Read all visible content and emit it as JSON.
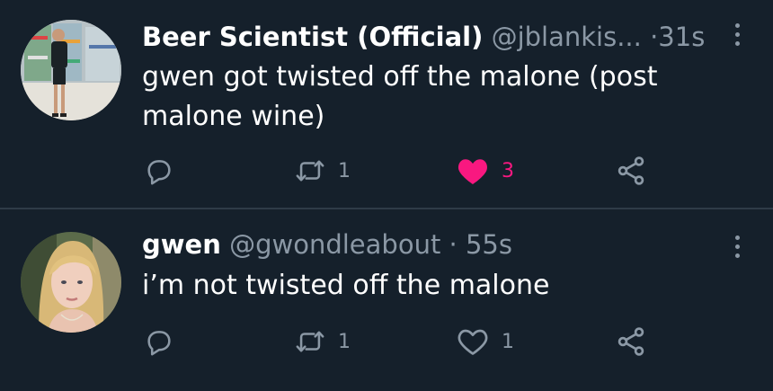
{
  "tweets": [
    {
      "name": "Beer Scientist (Official)",
      "handle": "@jblankis...",
      "separator": "·",
      "time": "31s",
      "text_lines": [
        "gwen got twisted off the malone (post",
        "malone wine)"
      ],
      "retweets": "1",
      "likes": "3",
      "liked": true
    },
    {
      "name": "gwen",
      "handle": "@gwondleabout",
      "separator": "·",
      "time": "55s",
      "text_lines": [
        "i’m not twisted off the malone"
      ],
      "retweets": "1",
      "likes": "1",
      "liked": false
    }
  ],
  "colors": {
    "background": "#15202b",
    "secondary_text": "#8b98a5",
    "like_pink": "#f91880",
    "divider": "#2f3b47"
  },
  "icons": [
    "reply-icon",
    "retweet-icon",
    "heart-icon",
    "share-icon",
    "more-icon"
  ]
}
